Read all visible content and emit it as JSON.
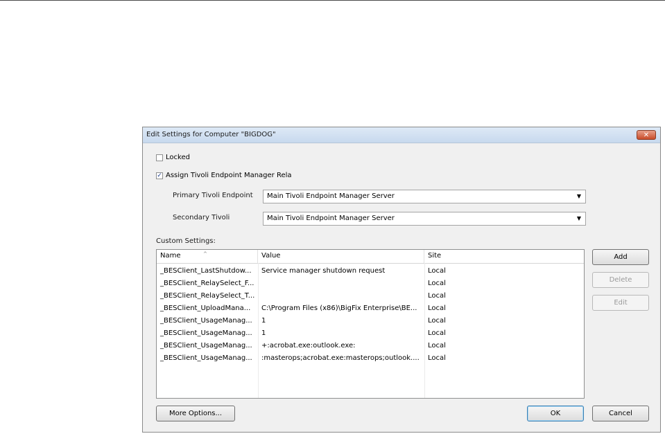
{
  "dialog": {
    "title": "Edit Settings for Computer \"BIGDOG\"",
    "close_symbol": "✕"
  },
  "options": {
    "locked": {
      "label": "Locked",
      "checked": false,
      "mark": ""
    },
    "assign_relay": {
      "label": "Assign Tivoli Endpoint Manager Rela",
      "checked": true,
      "mark": "✓"
    }
  },
  "relays": {
    "primary": {
      "label": "Primary Tivoli Endpoint",
      "value": "Main Tivoli Endpoint Manager Server"
    },
    "secondary": {
      "label": "Secondary Tivoli",
      "value": "Main Tivoli Endpoint Manager Server"
    },
    "dropdown_arrow": "▼"
  },
  "custom_settings": {
    "label": "Custom Settings:",
    "sort_indicator": "^",
    "columns": [
      "Name",
      "Value",
      "Site"
    ],
    "rows": [
      {
        "name": "_BESClient_LastShutdow...",
        "value": "Service manager shutdown request",
        "site": "Local"
      },
      {
        "name": "_BESClient_RelaySelect_F...",
        "value": "",
        "site": "Local"
      },
      {
        "name": "_BESClient_RelaySelect_T...",
        "value": "",
        "site": "Local"
      },
      {
        "name": "_BESClient_UploadMana...",
        "value": "C:\\Program Files (x86)\\BigFix Enterprise\\BE...",
        "site": "Local"
      },
      {
        "name": "_BESClient_UsageManag...",
        "value": "1",
        "site": "Local"
      },
      {
        "name": "_BESClient_UsageManag...",
        "value": "1",
        "site": "Local"
      },
      {
        "name": "_BESClient_UsageManag...",
        "value": "+:acrobat.exe:outlook.exe:",
        "site": "Local"
      },
      {
        "name": "_BESClient_UsageManag...",
        "value": ":masterops;acrobat.exe:masterops;outlook....",
        "site": "Local"
      }
    ]
  },
  "buttons": {
    "add": "Add",
    "delete": "Delete",
    "edit": "Edit",
    "more_options": "More Options...",
    "ok": "OK",
    "cancel": "Cancel"
  },
  "colors": {
    "title_bar": "#c8d9ee",
    "close_button": "#c84b2a",
    "dialog_bg": "#f0f0f0",
    "default_button_border": "#3c7fb1"
  }
}
